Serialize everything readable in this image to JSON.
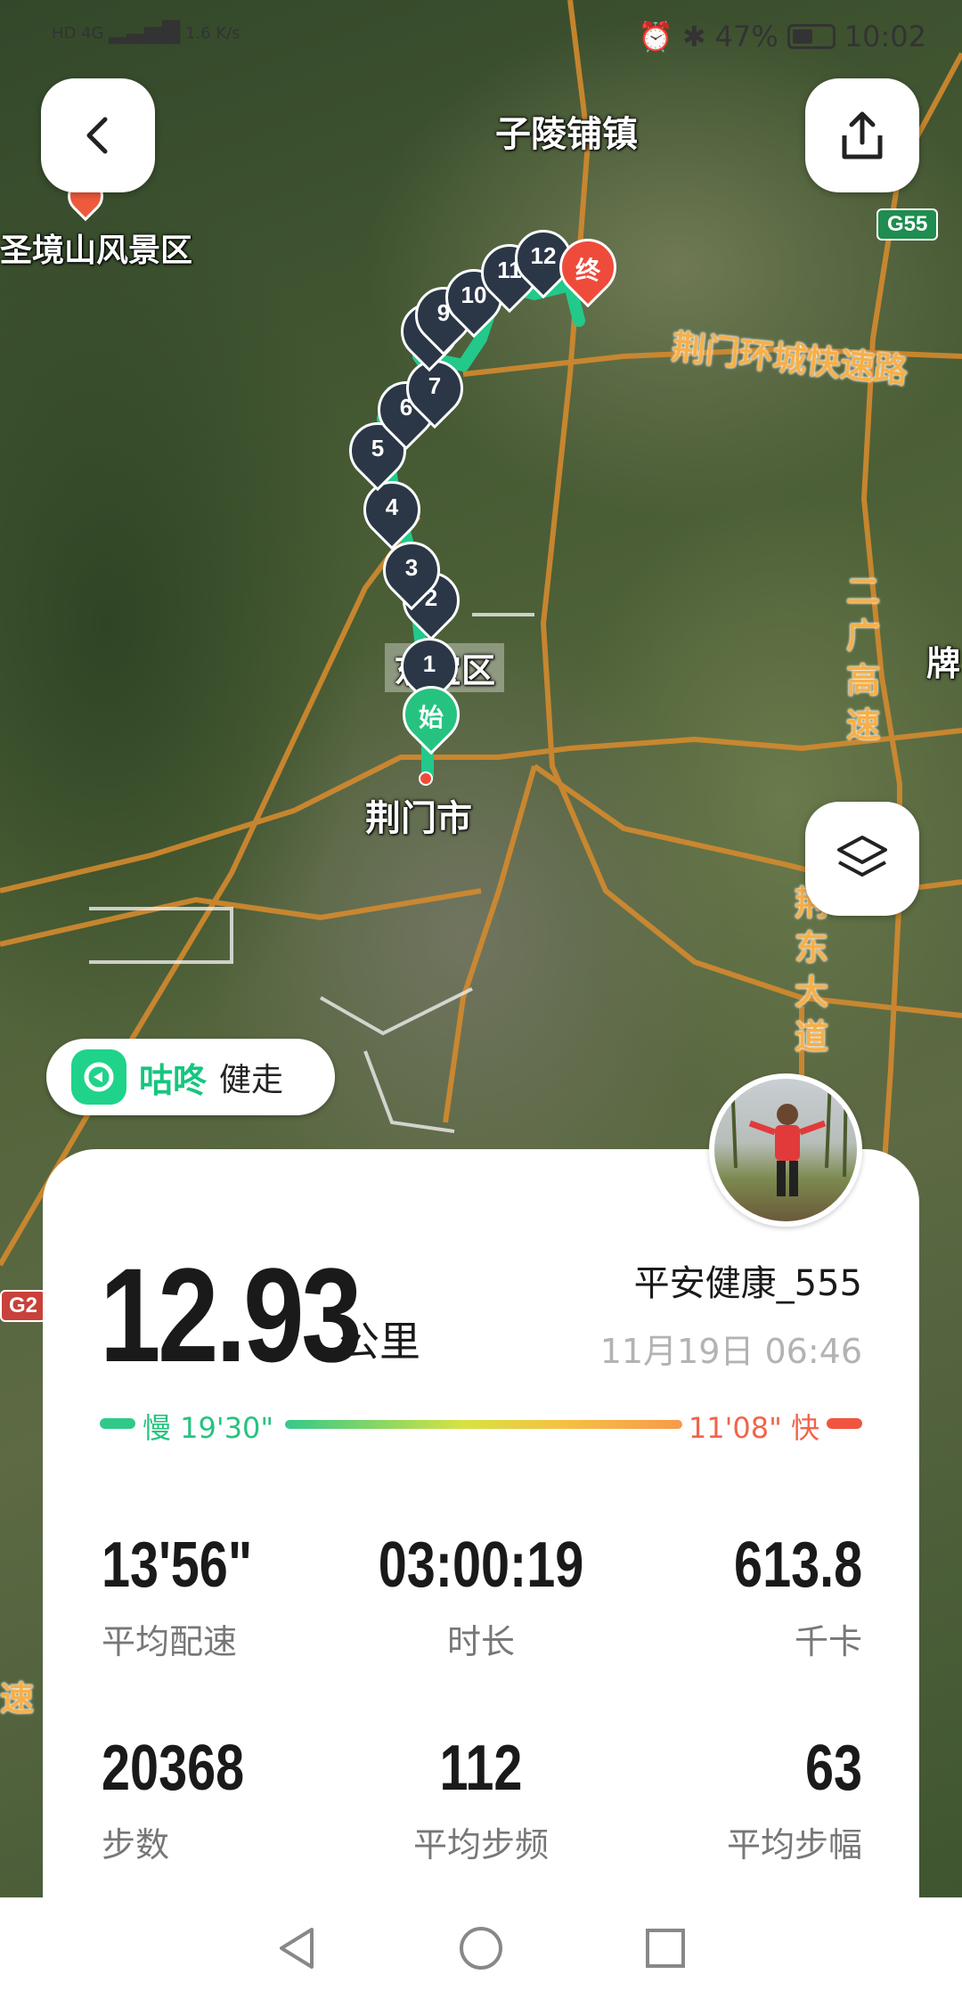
{
  "status_bar": {
    "network": "HD 4G",
    "speed": "1.6 K/s",
    "battery": "47%",
    "time": "10:02"
  },
  "map": {
    "labels": {
      "town_top": "子陵铺镇",
      "scenic": "圣境山风景区",
      "district": "东宝区",
      "city": "荆门市",
      "jing": "牌"
    },
    "roads": {
      "ring": "荆门环城快速路",
      "expressway": "二广高速",
      "avenue": "荆东大道",
      "g55": "G55",
      "g2": "G2",
      "su": "速"
    },
    "markers": [
      "1",
      "2",
      "3",
      "4",
      "5",
      "6",
      "7",
      "8",
      "9",
      "10",
      "11",
      "12"
    ],
    "start_label": "始",
    "end_label": "终"
  },
  "app_badge": {
    "brand": "咕咚",
    "mode": "健走"
  },
  "summary": {
    "distance": "12.93",
    "distance_unit": "公里",
    "user_name": "平安健康_555",
    "date": "11月19日 06:46",
    "pace_slow": "慢 19'30\"",
    "pace_fast": "11'08\" 快"
  },
  "stats": [
    {
      "value": "13'56\"",
      "label": "平均配速"
    },
    {
      "value": "03:00:19",
      "label": "时长"
    },
    {
      "value": "613.8",
      "label": "千卡"
    },
    {
      "value": "20368",
      "label": "步数"
    },
    {
      "value": "112",
      "label": "平均步频"
    },
    {
      "value": "63",
      "label": "平均步幅"
    }
  ],
  "colors": {
    "route": "#22c98a",
    "marker": "#2b3747",
    "start": "#25c37f",
    "end": "#ef4b3b"
  }
}
